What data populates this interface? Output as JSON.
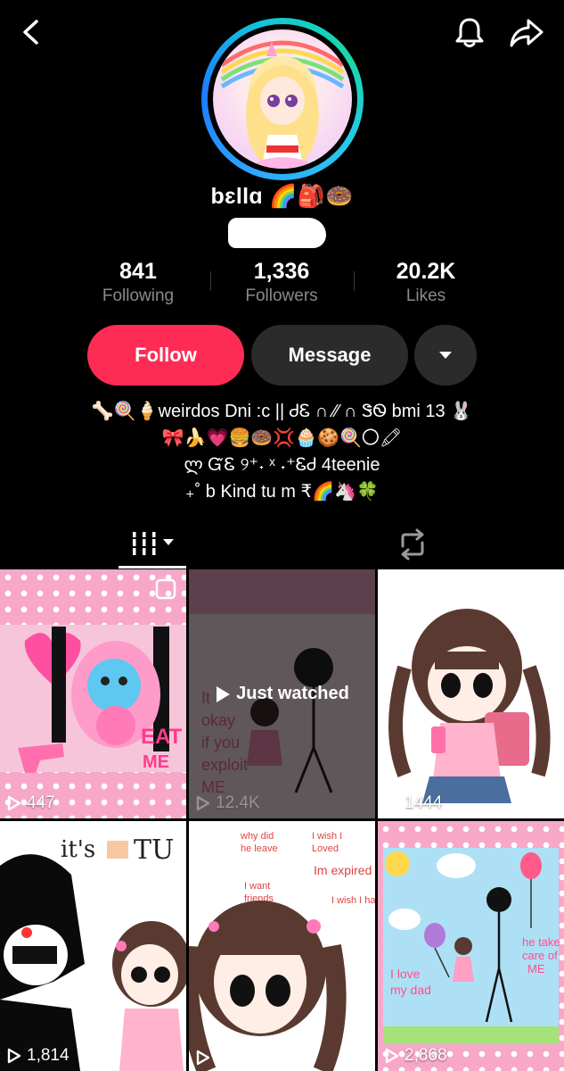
{
  "profile": {
    "name": "bɛllɑ 🌈🎒🍩",
    "stats": [
      {
        "value": "841",
        "label": "Following"
      },
      {
        "value": "1,336",
        "label": "Followers"
      },
      {
        "value": "20.2K",
        "label": "Likes"
      }
    ]
  },
  "buttons": {
    "follow": "Follow",
    "message": "Message"
  },
  "bio": [
    "🦴🍭🍦weirdos Dni :c || ᏧᏋ ∩ ⁄⁄ ∩ ᏕᏫ bmi 13 🐰",
    "🎀🍌💗🍔🍩💢🧁🍪🍭〇🖍",
    "ლ ᏳᏋ ୨⁺˖ ˣ ˖⁺ᏋᏧ 4teenie",
    "₊˚ b Kind tu m   ₹🌈🦄🍀"
  ],
  "videos": [
    {
      "views": "447",
      "theme": "pink-dots"
    },
    {
      "views": "12.4K",
      "theme": "dark-sketch",
      "overlay": "Just watched"
    },
    {
      "views": "1444",
      "theme": "white-drawing"
    },
    {
      "views": "1,814",
      "theme": "white-drawing"
    },
    {
      "views": "",
      "theme": "white-drawing"
    },
    {
      "views": "2,868",
      "theme": "pink-dots"
    }
  ],
  "colors": {
    "accent": "#fe2c55",
    "secondary_button": "#2b2b2b",
    "muted_text": "#8a8a8a"
  }
}
